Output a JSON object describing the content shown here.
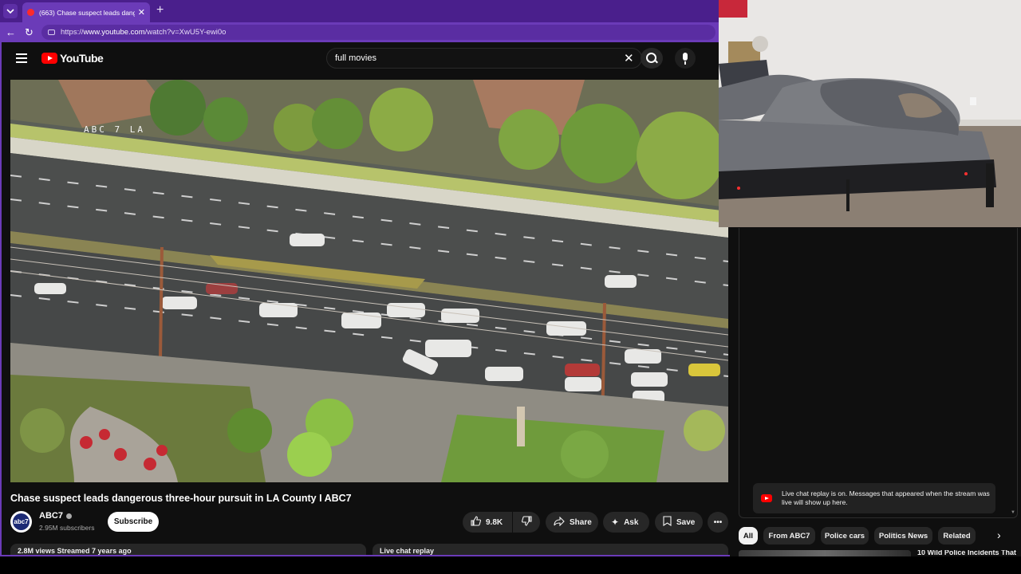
{
  "browser": {
    "tab_title": "(663) Chase suspect leads dangerous three-hour pursuit in LA County I ABC7",
    "url_prefix": "https://",
    "url_domain": "www.youtube.com",
    "url_path": "/watch?v=XwU5Y-ewi0o"
  },
  "youtube": {
    "logo_text": "YouTube",
    "search": {
      "value": "full movies"
    },
    "video": {
      "watermark": "ABC 7 LA",
      "title": "Chase suspect leads dangerous three-hour pursuit in LA County I ABC7"
    },
    "channel": {
      "avatar_text": "abc7",
      "name": "ABC7",
      "subscribers": "2.95M subscribers",
      "subscribe_label": "Subscribe"
    },
    "actions": {
      "likes": "9.8K",
      "share_label": "Share",
      "ask_label": "Ask",
      "save_label": "Save"
    },
    "description": {
      "stats": "2.8M views  Streamed 7 years ago"
    },
    "chat": {
      "replay_label": "Live chat replay",
      "notice": "Live chat replay is on. Messages that appeared when the stream was live will show up here."
    },
    "chips": [
      "All",
      "From ABC7",
      "Police cars",
      "Politics News",
      "Related"
    ],
    "recommendation_title": "10 Wild Police Incidents That"
  },
  "colors": {
    "browser_accent": "#6b3bb8",
    "youtube_red": "#ff0000",
    "background": "#0f0f0f"
  }
}
